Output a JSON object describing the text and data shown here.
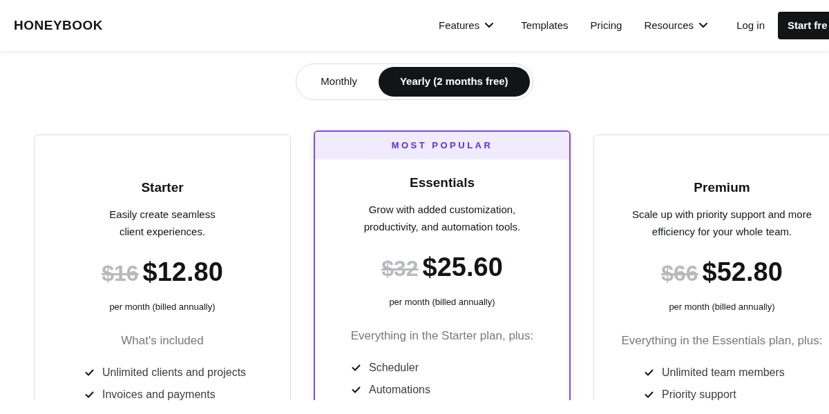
{
  "header": {
    "logo": "HONEYBOOK",
    "nav": [
      {
        "label": "Features",
        "dropdown": true
      },
      {
        "label": "Templates",
        "dropdown": false
      },
      {
        "label": "Pricing",
        "dropdown": false
      },
      {
        "label": "Resources",
        "dropdown": true
      }
    ],
    "login": "Log in",
    "cta": "Start fre"
  },
  "billing_toggle": [
    {
      "label": "Monthly",
      "selected": false
    },
    {
      "label": "Yearly (2 months free)",
      "selected": true
    }
  ],
  "plans": [
    {
      "highlighted": false,
      "name": "Starter",
      "description": "Easily create seamless client experiences.",
      "old_price": "$16",
      "price": "$12.80",
      "price_note": "per month (billed annually)",
      "features_heading": "What's included",
      "features": [
        "Unlimited clients and projects",
        "Invoices and payments"
      ]
    },
    {
      "highlighted": true,
      "badge": "MOST POPULAR",
      "name": "Essentials",
      "description": "Grow with added customization, productivity, and automation tools.",
      "old_price": "$32",
      "price": "$25.60",
      "price_note": "per month (billed annually)",
      "features_heading": "Everything in the Starter plan, plus:",
      "features": [
        "Scheduler",
        "Automations"
      ]
    },
    {
      "highlighted": false,
      "name": "Premium",
      "description": "Scale up with priority support and more efficiency for your whole team.",
      "old_price": "$66",
      "price": "$52.80",
      "price_note": "per month (billed annually)",
      "features_heading": "Everything in the Essentials plan, plus:",
      "features": [
        "Unlimited team members",
        "Priority support"
      ]
    }
  ]
}
